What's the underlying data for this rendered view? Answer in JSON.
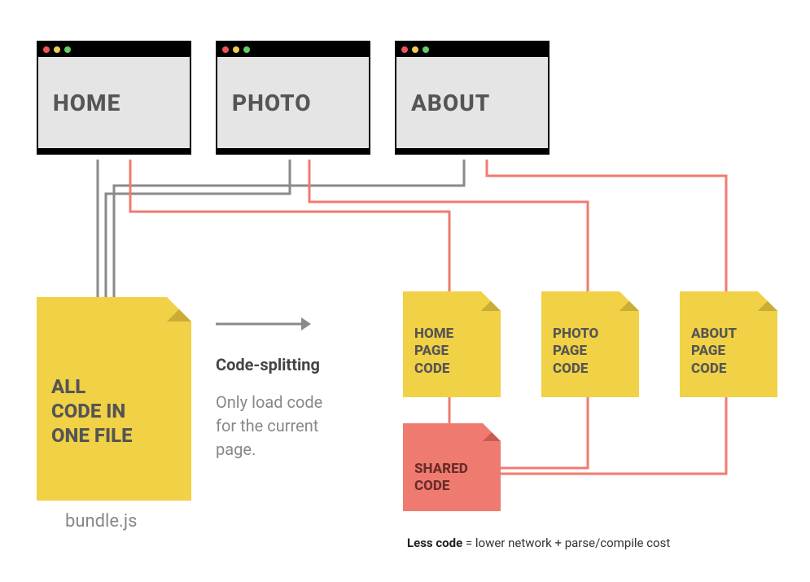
{
  "browsers": {
    "home": "HOME",
    "photo": "PHOTO",
    "about": "ABOUT"
  },
  "bundle": {
    "label": "ALL\nCODE IN\nONE FILE",
    "caption": "bundle.js"
  },
  "middle": {
    "title": "Code-splitting",
    "subtitle": "Only load code\nfor the current\npage."
  },
  "chunks": {
    "home": "HOME\nPAGE\nCODE",
    "photo": "PHOTO\nPAGE\nCODE",
    "about": "ABOUT\nPAGE\nCODE",
    "shared": "SHARED\nCODE"
  },
  "footnote": {
    "bold": "Less code",
    "rest": " = lower network + parse/compile cost"
  },
  "colors": {
    "gray_line": "#888888",
    "red_line": "#ef7b70"
  }
}
